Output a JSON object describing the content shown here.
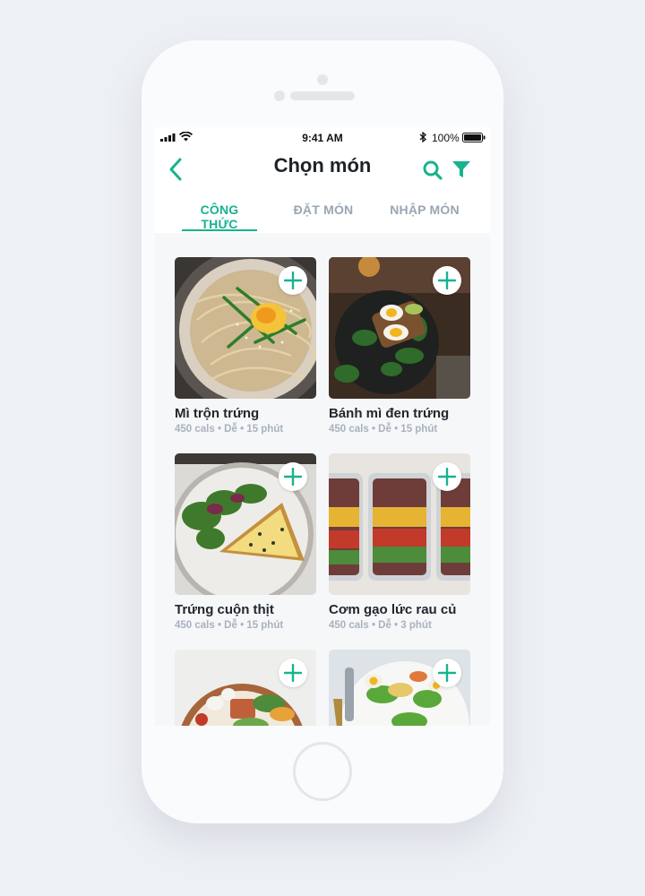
{
  "status_bar": {
    "time": "9:41 AM",
    "battery": "100%"
  },
  "header": {
    "title": "Chọn món",
    "back_icon": "chevron-left-icon",
    "search_icon": "search-icon",
    "filter_icon": "filter-icon"
  },
  "tabs": [
    {
      "label": "CÔNG THỨC",
      "active": true
    },
    {
      "label": "ĐẶT MÓN",
      "active": false
    },
    {
      "label": "NHẬP MÓN",
      "active": false
    }
  ],
  "colors": {
    "accent": "#17b38f",
    "text_dark": "#22272c",
    "text_muted": "#a8b2be"
  },
  "recipes": [
    {
      "title": "Mì trộn trứng",
      "meta": "450 cals • Dễ • 15 phút"
    },
    {
      "title": "Bánh mì đen trứng",
      "meta": "450 cals • Dễ • 15 phút"
    },
    {
      "title": "Trứng cuộn thịt",
      "meta": "450 cals • Dễ • 15 phút"
    },
    {
      "title": "Cơm gạo lức rau củ",
      "meta": "450 cals • Dễ • 3 phút"
    },
    {
      "title": "",
      "meta": ""
    },
    {
      "title": "",
      "meta": ""
    }
  ]
}
